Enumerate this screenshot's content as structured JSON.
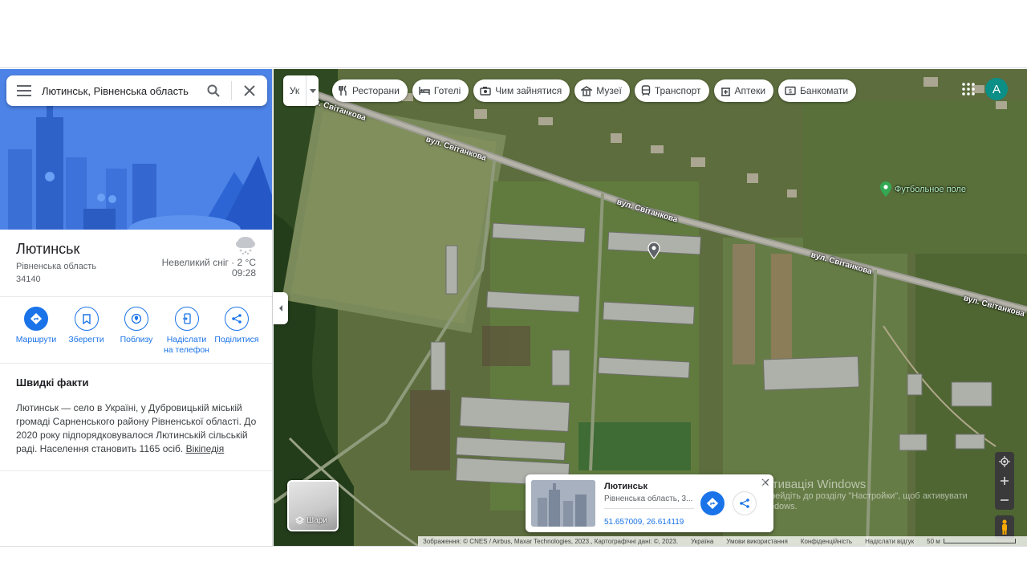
{
  "search": {
    "value": "Лютинськ, Рівненська область",
    "menu_icon": "hamburger-menu-icon",
    "search_icon": "search-icon",
    "clear_icon": "close-icon"
  },
  "place": {
    "title": "Лютинськ",
    "region": "Рівненська область",
    "postal_code": "34140",
    "weather": {
      "description": "Невеликий сніг · 2 °C",
      "time": "09:28",
      "icon": "snow-cloud-icon"
    }
  },
  "actions": [
    {
      "label": "Маршрути",
      "icon": "directions-icon"
    },
    {
      "label": "Зберегти",
      "icon": "bookmark-icon"
    },
    {
      "label": "Поблизу",
      "icon": "nearby-icon"
    },
    {
      "label": "Надіслати на телефон",
      "icon": "send-to-phone-icon"
    },
    {
      "label": "Поділитися",
      "icon": "share-icon"
    }
  ],
  "quick_facts": {
    "title": "Швидкі факти",
    "text": "Лютинськ — село в Україні, у Дубровицькій міській громаді Сарненського району Рівненської області. До 2020 року підпорядковувалося Лютинській сільській раді. Населення становить 1165 осіб.",
    "link": "Вікіпедія"
  },
  "map": {
    "language_toggle": "Ук",
    "chips": [
      {
        "label": "Ресторани",
        "icon": "restaurant-icon"
      },
      {
        "label": "Готелі",
        "icon": "hotel-icon"
      },
      {
        "label": "Чим зайнятися",
        "icon": "camera-icon"
      },
      {
        "label": "Музеї",
        "icon": "museum-icon"
      },
      {
        "label": "Транспорт",
        "icon": "transit-icon"
      },
      {
        "label": "Аптеки",
        "icon": "pharmacy-icon"
      },
      {
        "label": "Банкомати",
        "icon": "atm-icon"
      }
    ],
    "avatar_letter": "A",
    "street_labels": [
      "вул. Світанкова",
      "вул. Світанкова",
      "вул. Світанкова",
      "вул. Світанкова",
      "вул. Світанкова"
    ],
    "poi": {
      "label": "Футбольное поле",
      "color": "#34a853"
    },
    "layers_label": "Шари",
    "info_card": {
      "title": "Лютинськ",
      "subtitle": "Рівненська область, 3...",
      "coordinates": "51.657009, 26.614119"
    },
    "watermark": {
      "title": "Активація Windows",
      "subtitle": "Перейдіть до розділу \"Настройки\", щоб активувати Windows."
    },
    "attribution": {
      "imagery": "Зображення: © CNES / Airbus, Maxar Technologies, 2023., Картографічні дані: ©, 2023.",
      "country": "Україна",
      "terms": "Умови використання",
      "privacy": "Конфіденційність",
      "feedback": "Надіслати відгук",
      "scale": "50 м"
    }
  },
  "colors": {
    "accent": "#1a73e8",
    "avatar": "#0b8f87",
    "hero": "#4f85e8"
  }
}
